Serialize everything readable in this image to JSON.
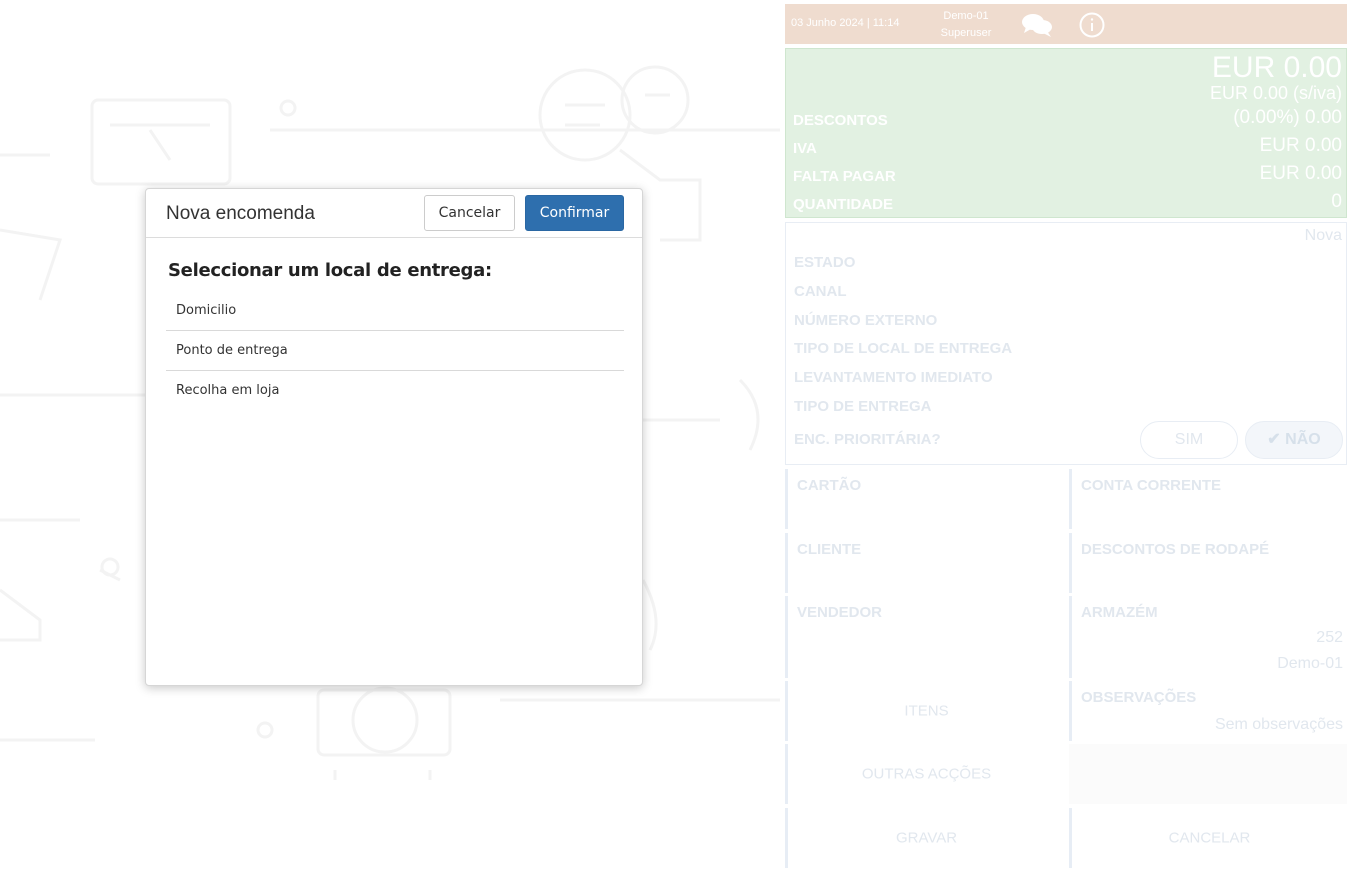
{
  "topbar": {
    "datetime": "03 Junho 2024 | 11:14",
    "store": "Demo-01",
    "role": "Superuser",
    "chat_icon": "chat-bubbles-icon",
    "info_icon": "info-circle-icon",
    "color": "#efdccf"
  },
  "totals": {
    "total": "EUR 0.00",
    "total_no_vat": "EUR 0.00 (s/iva)",
    "rows": [
      {
        "label": "DESCONTOS",
        "value": "(0.00%) 0.00"
      },
      {
        "label": "IVA",
        "value": "EUR 0.00"
      },
      {
        "label": "FALTA PAGAR",
        "value": "EUR 0.00"
      },
      {
        "label": "QUANTIDADE",
        "value": "0"
      }
    ],
    "color": "#e2f1e2"
  },
  "status": {
    "value": "Nova",
    "rows": [
      "ESTADO",
      "CANAL",
      "NÚMERO EXTERNO",
      "TIPO DE LOCAL DE ENTREGA",
      "LEVANTAMENTO IMEDIATO",
      "TIPO DE ENTREGA",
      "ENC. PRIORITÁRIA?"
    ],
    "priority_yes": "SIM",
    "priority_no": "NÃO"
  },
  "tiles": {
    "card": "CARTÃO",
    "current_account": "CONTA CORRENTE",
    "client": "CLIENTE",
    "footer_discounts": "DESCONTOS DE RODAPÉ",
    "seller": "VENDEDOR",
    "warehouse": "ARMAZÉM",
    "warehouse_code": "252",
    "warehouse_name": "Demo-01",
    "items": "ITENS",
    "notes": "OBSERVAÇÕES",
    "notes_value": "Sem observações",
    "other_actions": "OUTRAS ACÇÕES",
    "save": "GRAVAR",
    "cancel": "CANCELAR"
  },
  "modal": {
    "title": "Nova encomenda",
    "cancel_label": "Cancelar",
    "confirm_label": "Confirmar",
    "prompt": "Seleccionar um local de entrega:",
    "options": [
      "Domicilio",
      "Ponto de entrega",
      "Recolha em loja"
    ],
    "accent": "#2e6fae"
  }
}
